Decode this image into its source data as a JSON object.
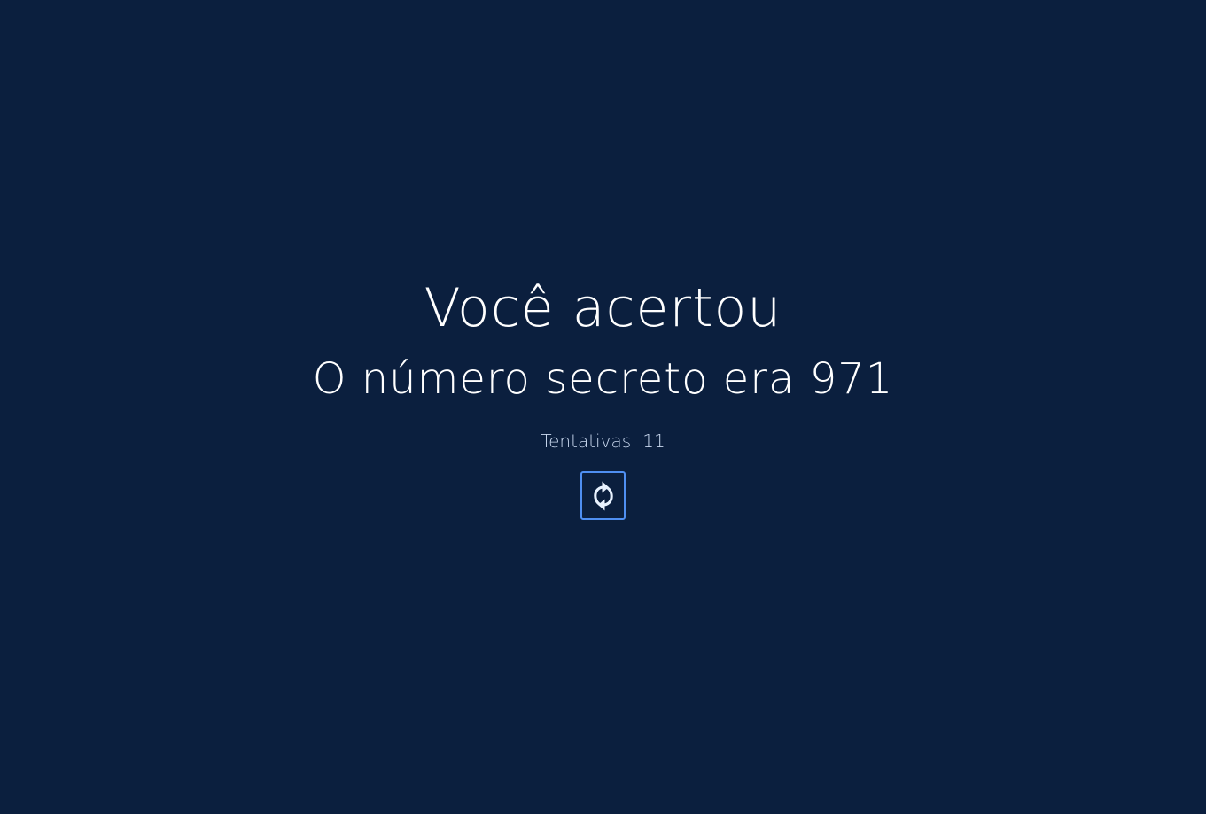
{
  "colors": {
    "background": "#0b1f3e",
    "text": "#ffffff",
    "muted_text": "#c9d8ef",
    "accent": "#4f8ff2",
    "icon": "#e8f2ff"
  },
  "result": {
    "title": "Você acertou",
    "secret_text": "O número secreto era 971",
    "attempts_label": "Tentativas:",
    "attempts_value": "11"
  },
  "actions": {
    "restart_icon": "refresh-icon"
  }
}
